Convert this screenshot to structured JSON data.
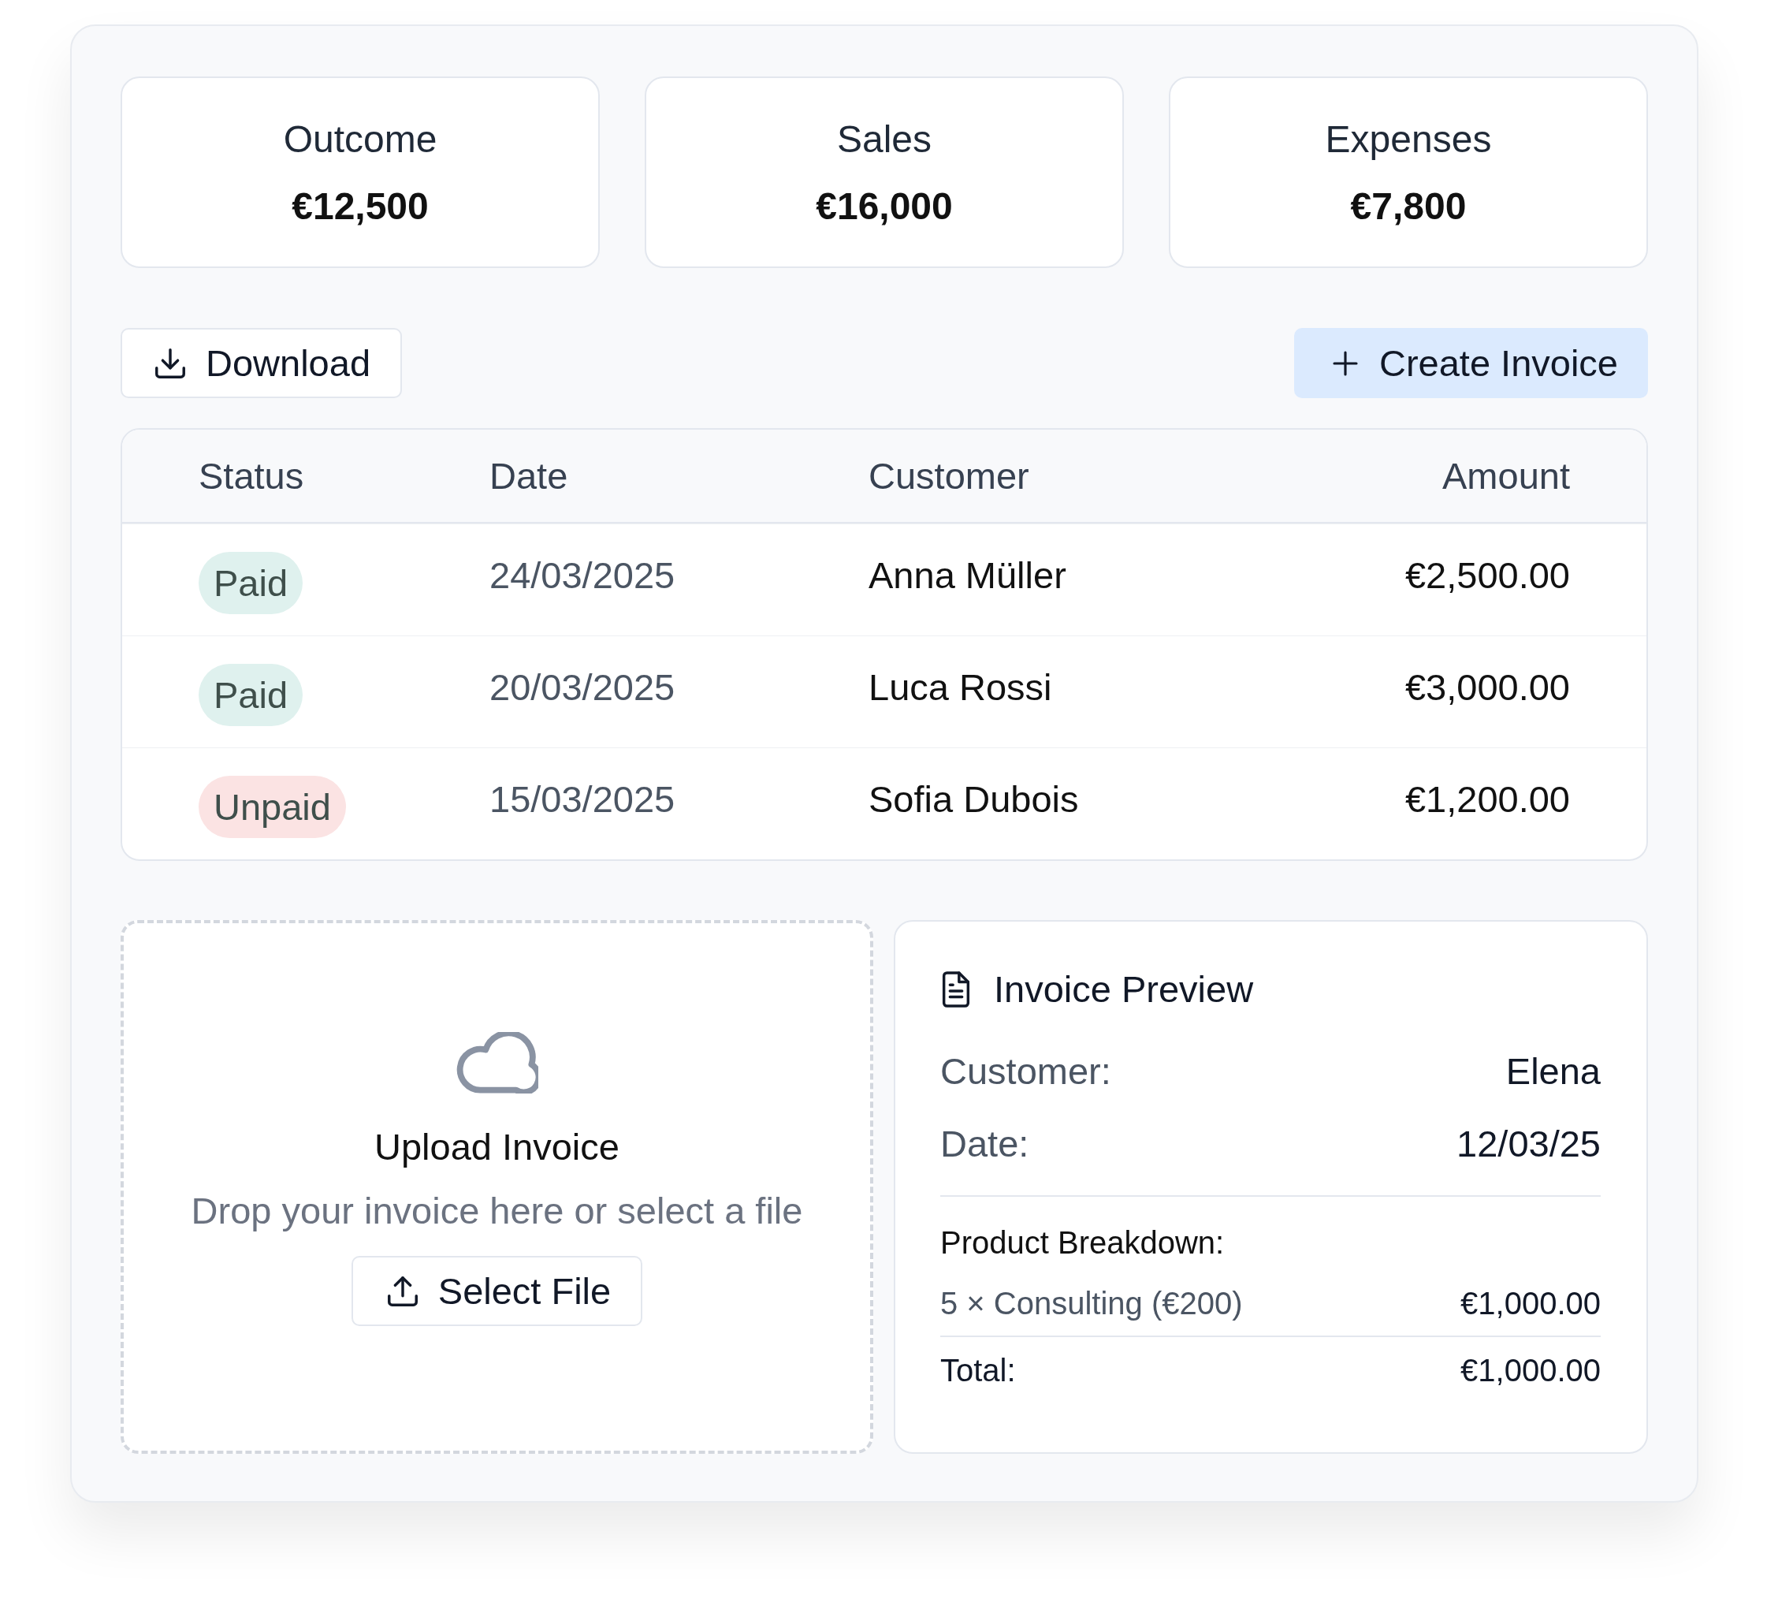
{
  "stats": [
    {
      "label": "Outcome",
      "value": "€12,500"
    },
    {
      "label": "Sales",
      "value": "€16,000"
    },
    {
      "label": "Expenses",
      "value": "€7,800"
    }
  ],
  "toolbar": {
    "download": "Download",
    "create": "Create Invoice"
  },
  "table": {
    "columns": [
      "Status",
      "Date",
      "Customer",
      "Amount"
    ],
    "rows": [
      {
        "status": "Paid",
        "kind": "paid",
        "date": "24/03/2025",
        "customer": "Anna Müller",
        "amount": "€2,500.00"
      },
      {
        "status": "Paid",
        "kind": "paid",
        "date": "20/03/2025",
        "customer": "Luca Rossi",
        "amount": "€3,000.00"
      },
      {
        "status": "Unpaid",
        "kind": "unpaid",
        "date": "15/03/2025",
        "customer": "Sofia Dubois",
        "amount": "€1,200.00"
      }
    ]
  },
  "upload": {
    "title": "Upload Invoice",
    "hint": "Drop your invoice here or select a file",
    "button": "Select File"
  },
  "preview": {
    "title": "Invoice Preview",
    "fields": [
      {
        "label": "Customer:",
        "value": "Elena"
      },
      {
        "label": "Date:",
        "value": "12/03/25"
      }
    ],
    "breakdown_title": "Product Breakdown:",
    "items": [
      {
        "label": "5 × Consulting (€200)",
        "amount": "€1,000.00"
      }
    ],
    "total": {
      "label": "Total:",
      "amount": "€1,000.00"
    }
  }
}
